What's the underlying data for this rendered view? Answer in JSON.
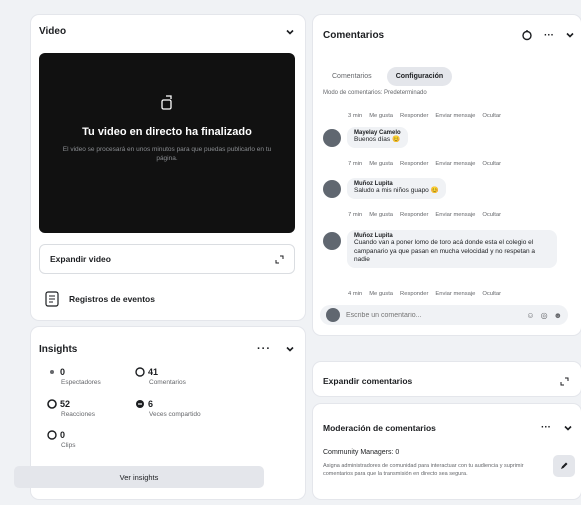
{
  "video": {
    "title": "Video",
    "screen_title": "Tu video en directo ha finalizado",
    "screen_desc": "El video se procesará en unos minutos para que puedas publicarlo en tu página.",
    "expand_label": "Expandir video",
    "event_log_label": "Registros de eventos"
  },
  "insights": {
    "title": "Insights",
    "metrics": [
      {
        "value": "0",
        "label": "Espectadores"
      },
      {
        "value": "41",
        "label": "Comentarios"
      },
      {
        "value": "52",
        "label": "Reacciones"
      },
      {
        "value": "6",
        "label": "Veces compartido"
      },
      {
        "value": "0",
        "label": "Clips"
      }
    ],
    "button_label": "Ver insights"
  },
  "comments": {
    "title": "Comentarios",
    "tabs": [
      "Comentarios",
      "Configuración"
    ],
    "mode_text": "Modo de comentarios: Predeterminado",
    "actions": {
      "time0": "3 min",
      "time1": "7 min",
      "time2": "7 min",
      "time3": "4 min",
      "like": "Me gusta",
      "reply": "Responder",
      "send": "Enviar mensaje",
      "hide": "Ocultar"
    },
    "items": [
      {
        "name": "Mayelay Camelo",
        "text": "Buenos días 😊"
      },
      {
        "name": "Muñoz Lupita",
        "text": "Saludo a mis niños guapo 😊"
      },
      {
        "name": "Muñoz Lupita",
        "text": "Cuando van a poner lomo de toro acá donde esta el colegio el campanario ya que pasan en mucha velocidad y no respetan a nadie"
      }
    ],
    "input_placeholder": "Escribe un comentario..."
  },
  "expand_comments": {
    "label": "Expandir comentarios"
  },
  "moderation": {
    "title": "Moderación de comentarios",
    "managers_label": "Community Managers: 0",
    "managers_desc": "Asigna administradores de comunidad para interactuar con tu audiencia y suprimir comentarios para que la transmisión en directo sea segura."
  },
  "colors": {
    "dark_screen": "#111111",
    "accent": "#1877f2",
    "muted": "#65676b"
  }
}
